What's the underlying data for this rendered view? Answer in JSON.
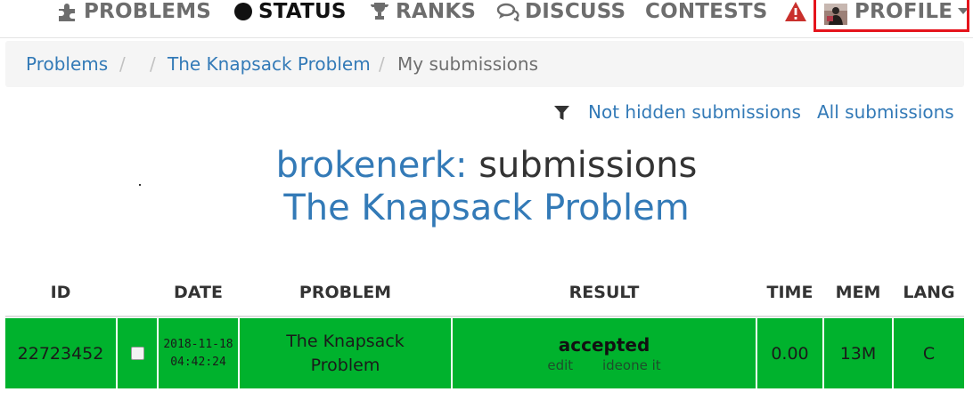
{
  "nav": {
    "items": [
      {
        "label": "PROBLEMS",
        "icon": "puzzle-icon"
      },
      {
        "label": "STATUS",
        "icon": "circle-icon"
      },
      {
        "label": "RANKS",
        "icon": "trophy-icon"
      },
      {
        "label": "DISCUSS",
        "icon": "chat-icon"
      },
      {
        "label": "CONTESTS",
        "icon": ""
      },
      {
        "label": "",
        "icon": "warning-icon"
      },
      {
        "label": "PROFILE",
        "icon": "avatar"
      }
    ],
    "active": "STATUS",
    "highlight_color": "#e5141c"
  },
  "breadcrumb": {
    "items": [
      "Problems",
      "The Knapsack Problem",
      "My submissions"
    ],
    "separator": "/"
  },
  "filters": {
    "not_hidden": "Not hidden submissions",
    "all": "All submissions"
  },
  "heading": {
    "user": "brokenerk:",
    "suffix": "submissions",
    "problem": "The Knapsack Problem"
  },
  "table": {
    "columns": [
      "ID",
      "DATE",
      "PROBLEM",
      "RESULT",
      "TIME",
      "MEM",
      "LANG"
    ],
    "rows": [
      {
        "id": "22723452",
        "date": "2018-11-18",
        "time_of_day": "04:42:24",
        "problem_line1": "The Knapsack",
        "problem_line2": "Problem",
        "result": "accepted",
        "action_edit": "edit",
        "action_ideone": "ideone it",
        "time": "0.00",
        "mem": "13M",
        "lang": "C"
      }
    ],
    "accepted_color": "#00b22d"
  }
}
